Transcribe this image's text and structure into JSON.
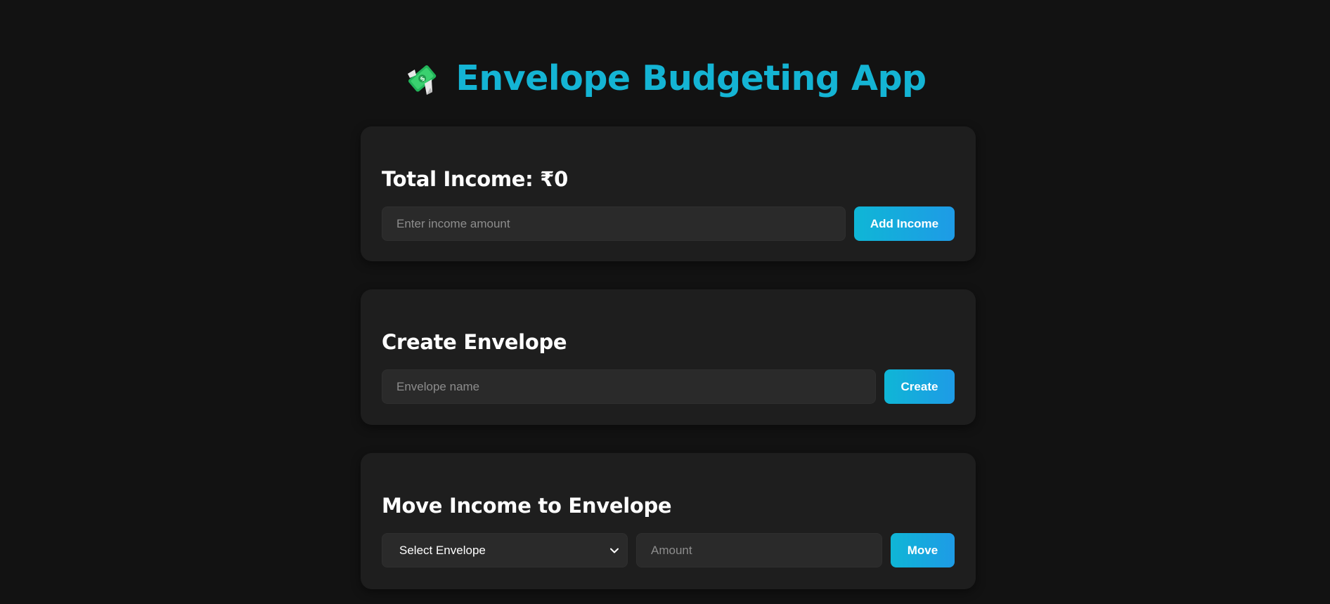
{
  "header": {
    "title": "Envelope Budgeting App",
    "logo_icon": "money-with-wings-icon"
  },
  "income": {
    "heading": "Total Income: ₹0",
    "input_placeholder": "Enter income amount",
    "input_value": "",
    "button_label": "Add Income"
  },
  "create": {
    "heading": "Create Envelope",
    "input_placeholder": "Envelope name",
    "input_value": "",
    "button_label": "Create"
  },
  "move": {
    "heading": "Move Income to Envelope",
    "select_value": "Select Envelope",
    "amount_placeholder": "Amount",
    "amount_value": "",
    "button_label": "Move"
  },
  "colors": {
    "background": "#121212",
    "card": "#1e1e1e",
    "accent": "#14b4d4",
    "button_gradient_start": "#0fb6d6",
    "button_gradient_end": "#1e9be6"
  }
}
